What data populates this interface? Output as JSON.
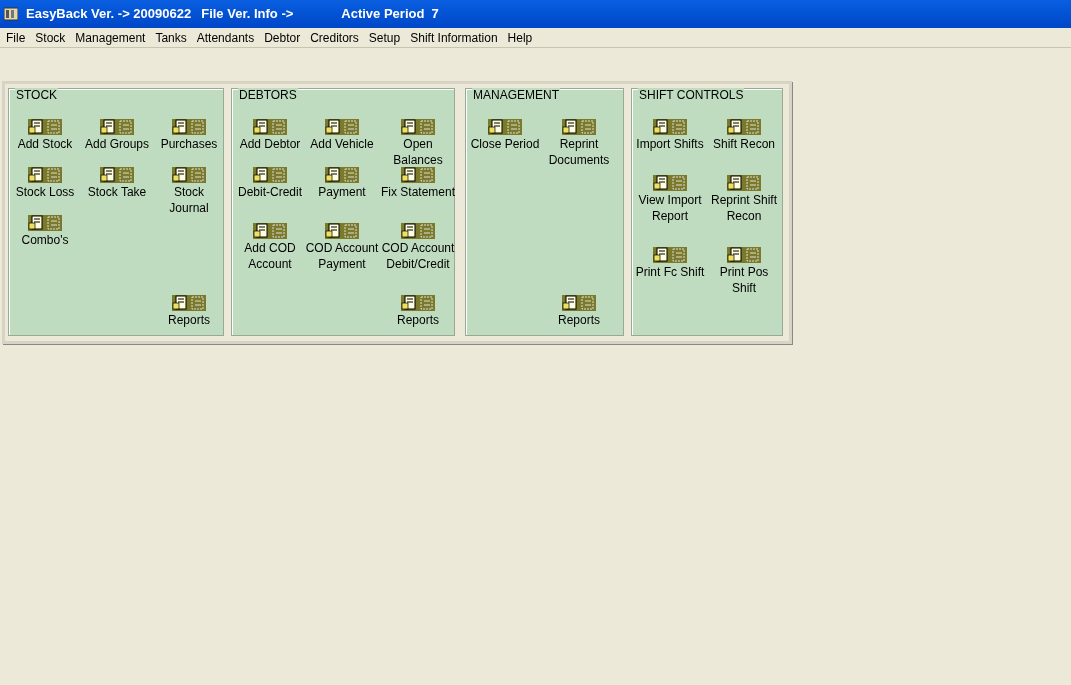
{
  "window": {
    "title_parts": [
      "EasyBack Ver. -> 20090622",
      "File Ver. Info ->",
      "Active Period  7"
    ]
  },
  "menu": [
    "File",
    "Stock",
    "Management",
    "Tanks",
    "Attendants",
    "Debtor",
    "Creditors",
    "Setup",
    "Shift Information",
    "Help"
  ],
  "panels": [
    {
      "kind": "stock",
      "title": "STOCK",
      "buttons": [
        {
          "label": "Add Stock"
        },
        {
          "label": "Add Groups"
        },
        {
          "label": "Purchases"
        },
        {
          "label": "Stock Loss"
        },
        {
          "label": "Stock Take"
        },
        {
          "label": "Stock Journal"
        },
        {
          "label": "Combo's"
        },
        {
          "label": "Reports"
        }
      ]
    },
    {
      "kind": "debtors",
      "title": "DEBTORS",
      "buttons": [
        {
          "label": "Add Debtor"
        },
        {
          "label": "Add Vehicle"
        },
        {
          "label": "Open Balances"
        },
        {
          "label": "Debit-Credit"
        },
        {
          "label": "Payment"
        },
        {
          "label": "Fix Statement"
        },
        {
          "label": "Add COD Account"
        },
        {
          "label": "COD Account Payment"
        },
        {
          "label": "COD Account Debit/Credit"
        },
        {
          "label": "Reports"
        }
      ]
    },
    {
      "kind": "management",
      "title": "MANAGEMENT",
      "buttons": [
        {
          "label": "Close Period"
        },
        {
          "label": "Reprint Documents"
        },
        {
          "label": "Reports"
        }
      ]
    },
    {
      "kind": "shift",
      "title": "SHIFT CONTROLS",
      "buttons": [
        {
          "label": "Import Shifts"
        },
        {
          "label": "Shift Recon"
        },
        {
          "label": "View Import Report"
        },
        {
          "label": "Reprint Shift Recon"
        },
        {
          "label": "Print Fc Shift"
        },
        {
          "label": "Print Pos Shift"
        }
      ]
    }
  ]
}
